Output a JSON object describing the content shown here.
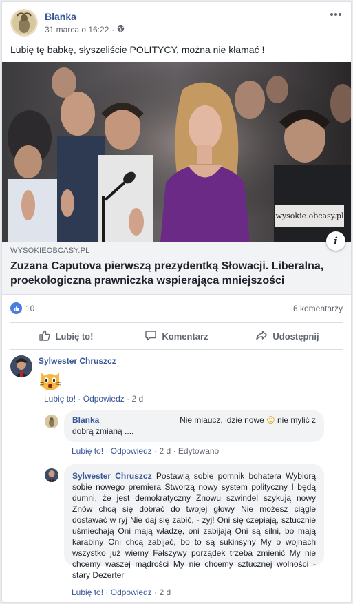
{
  "post": {
    "author": "Blanka",
    "date": "31 marca o 16:22",
    "separator": "·",
    "privacy_icon": "globe-icon",
    "text": "Lubię tę babkę, słyszeliście POLITYCY, można nie kłamać !",
    "image_watermark": "wysokie obcasy.pl",
    "link": {
      "domain": "WYSOKIEOBCASY.PL",
      "headline": "Zuzana Caputova pierwszą prezydentką Słowacji. Liberalna, proekologiczna prawniczka wspierająca mniejszości",
      "info_label": "i"
    },
    "likes": "10",
    "comments_count": "6 komentarzy"
  },
  "actions": {
    "like": "Lubię to!",
    "comment": "Komentarz",
    "share": "Udostępnij"
  },
  "comments": [
    {
      "author": "Sylwester Chruszcz",
      "sticker": "surprised-cat-sticker",
      "actions": {
        "like": "Lubię to!",
        "reply": "Odpowiedz",
        "time": "2 d",
        "dot": "·"
      }
    },
    {
      "author": "Blanka",
      "text_pre": "Nie miaucz, idzie nowe",
      "emoji": "😉",
      "text_post": "nie mylić z dobrą zmianą ....",
      "actions": {
        "like": "Lubię to!",
        "reply": "Odpowiedz",
        "time": "2 d",
        "edited": "Edytowano",
        "dot": "·"
      }
    },
    {
      "author": "Sylwester Chruszcz",
      "text": "Postawią sobie pomnik bohatera Wybiorą sobie nowego premiera Stworzą nowy system polityczny I będą dumni, że jest demokratyczny Znowu szwindel szykują nowy Znów chcą się dobrać do twojej głowy Nie możesz ciągle dostawać w ryj Nie daj się zabić, - żyj! Oni się czepiają, sztucznie uśmiechają Oni mają władzę, oni zabijają Oni są silni, bo mają karabiny Oni chcą zabijać, bo to są sukinsyny My o wojnach wszystko już wiemy Fałszywy porządek trzeba zmienić My nie chcemy waszej mądrości My nie chcemy sztucznej wolności - stary Dezerter",
      "actions": {
        "like": "Lubię to!",
        "reply": "Odpowiedz",
        "time": "2 d",
        "dot": "·"
      }
    }
  ],
  "colors": {
    "link": "#385898",
    "like_blue": "#4a7be0",
    "dress": "#6b2a86"
  }
}
